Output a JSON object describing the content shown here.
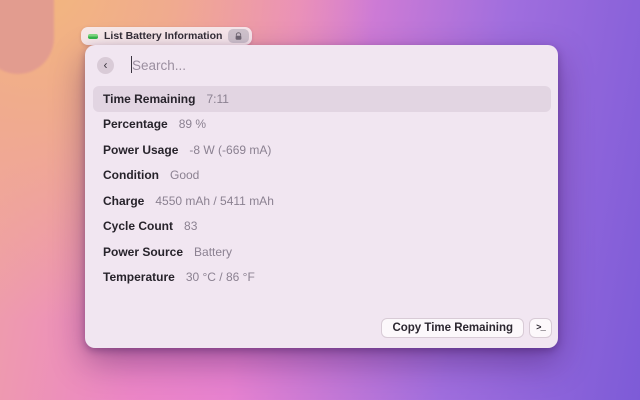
{
  "header": {
    "command_label": "List Battery Information",
    "command_icon": "green-battery-bar-icon",
    "lock_icon": "lock-icon"
  },
  "search": {
    "back_glyph": "‹",
    "placeholder": "Search..."
  },
  "rows": [
    {
      "label": "Time Remaining",
      "value": "7:11",
      "selected": true
    },
    {
      "label": "Percentage",
      "value": "89 %",
      "selected": false
    },
    {
      "label": "Power Usage",
      "value": "-8 W (-669 mA)",
      "selected": false
    },
    {
      "label": "Condition",
      "value": "Good",
      "selected": false
    },
    {
      "label": "Charge",
      "value": "4550 mAh / 5411 mAh",
      "selected": false
    },
    {
      "label": "Cycle Count",
      "value": "83",
      "selected": false
    },
    {
      "label": "Power Source",
      "value": "Battery",
      "selected": false
    },
    {
      "label": "Temperature",
      "value": "30 °C / 86 °F",
      "selected": false
    }
  ],
  "footer": {
    "primary_action": "Copy Time Remaining",
    "terminal_glyph": ">_"
  },
  "colors": {
    "accent_green": "#35b54a",
    "window_bg": "#f1e6f1",
    "selected_row_bg": "#e2d5e2",
    "gradient_orange": "#f3b77d",
    "gradient_pink": "#e782d0",
    "gradient_purple": "#7d5bd7"
  }
}
